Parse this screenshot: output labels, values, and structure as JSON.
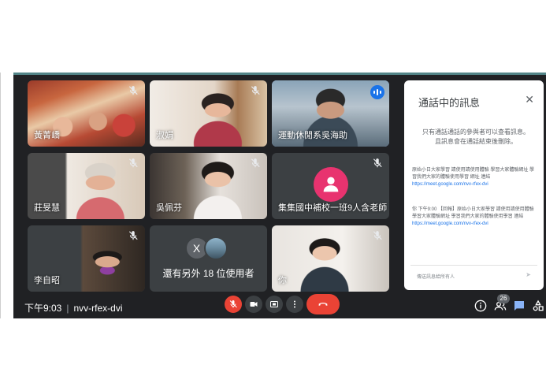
{
  "meeting": {
    "time": "下午9:03",
    "code": "nvv-rfex-dvi",
    "participant_count": "26"
  },
  "tiles": [
    {
      "name": "黃菁嶠",
      "muted": true
    },
    {
      "name": "淑娟",
      "muted": true
    },
    {
      "name": "運動休閒系吳海助",
      "muted": false,
      "speaking": true
    },
    {
      "name": "莊旻慧",
      "muted": true
    },
    {
      "name": "吳佩芬",
      "muted": true
    },
    {
      "name": "集集國中補校一班9人含老師",
      "muted": true
    },
    {
      "name": "李自昭",
      "muted": true
    },
    {
      "name": "還有另外 18 位使用者",
      "avatar_letter": "X"
    },
    {
      "name": "你",
      "muted": true
    }
  ],
  "chat_panel": {
    "title": "通話中的訊息",
    "close_icon": "close-icon",
    "note": "只有通話通話的參與者可以查看訊息。且訊息會在通話結束後刪除。",
    "messages": [
      {
        "text": "原始小日大家學習 請使用請使用體驗 學習大家體驗網址 學習我們大家的體驗使用學習 網址 連結",
        "link": "https://meet.google.com/nvv-rfex-dvi"
      },
      {
        "text": "你 下午9:00 【回報】原始小日大家學習 請使用請使用體驗 學習大家體驗網址 學習我們大家的體驗使用學習 連結",
        "link": "https://meet.google.com/nvv-rfex-dvi"
      }
    ],
    "input_placeholder": "傳送訊息給所有人",
    "send_icon": "send-icon"
  },
  "controls": {
    "mic": "mic-off-icon",
    "camera": "videocam-icon",
    "present": "present-icon",
    "more": "more-vert-icon",
    "hangup": "call-end-icon",
    "info": "info-icon",
    "people": "people-icon",
    "chat": "chat-icon",
    "activities": "activities-icon"
  },
  "colors": {
    "background": "#202124",
    "tile": "#3c4043",
    "hangup": "#ea4335",
    "accent": "#1a73e8"
  }
}
